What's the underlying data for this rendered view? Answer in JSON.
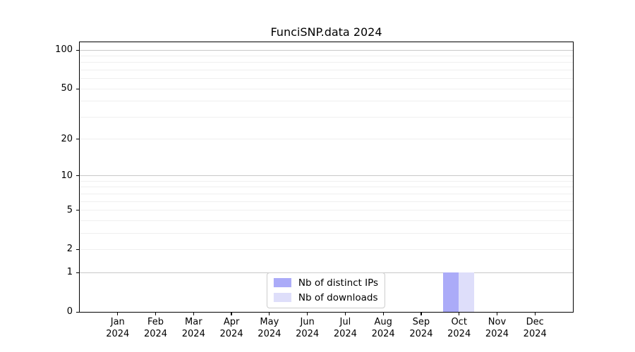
{
  "title": "FunciSNP.data 2024",
  "chart_data": {
    "type": "bar",
    "title": "FunciSNP.data 2024",
    "categories": [
      "Jan",
      "Feb",
      "Mar",
      "Apr",
      "May",
      "Jun",
      "Jul",
      "Aug",
      "Sep",
      "Oct",
      "Nov",
      "Dec"
    ],
    "x_tick_year": "2024",
    "series": [
      {
        "name": "Nb of distinct IPs",
        "color": "#ababf8",
        "values": [
          0,
          0,
          0,
          0,
          0,
          0,
          0,
          0,
          0,
          1,
          0,
          0
        ]
      },
      {
        "name": "Nb of downloads",
        "color": "#dedefa",
        "values": [
          0,
          0,
          0,
          0,
          0,
          0,
          0,
          0,
          0,
          1,
          0,
          0
        ]
      }
    ],
    "xlabel": "",
    "ylabel": "",
    "y_scale": "log10(1+v)",
    "ylim": [
      0,
      115
    ],
    "y_ticks_labeled": [
      0,
      1,
      2,
      5,
      10,
      20,
      50,
      100
    ],
    "y_gridlines_major": [
      1,
      10,
      100
    ],
    "y_gridlines_minor": [
      2,
      3,
      4,
      5,
      6,
      7,
      8,
      9,
      20,
      30,
      40,
      50,
      60,
      70,
      80,
      90
    ],
    "grid": "horizontal",
    "legend_position": "lower center",
    "colors": {
      "major_grid": "#c8c8c8",
      "minor_grid": "#efefef",
      "spine": "#000000",
      "legend_border": "#cccccc",
      "text": "#000000"
    }
  }
}
